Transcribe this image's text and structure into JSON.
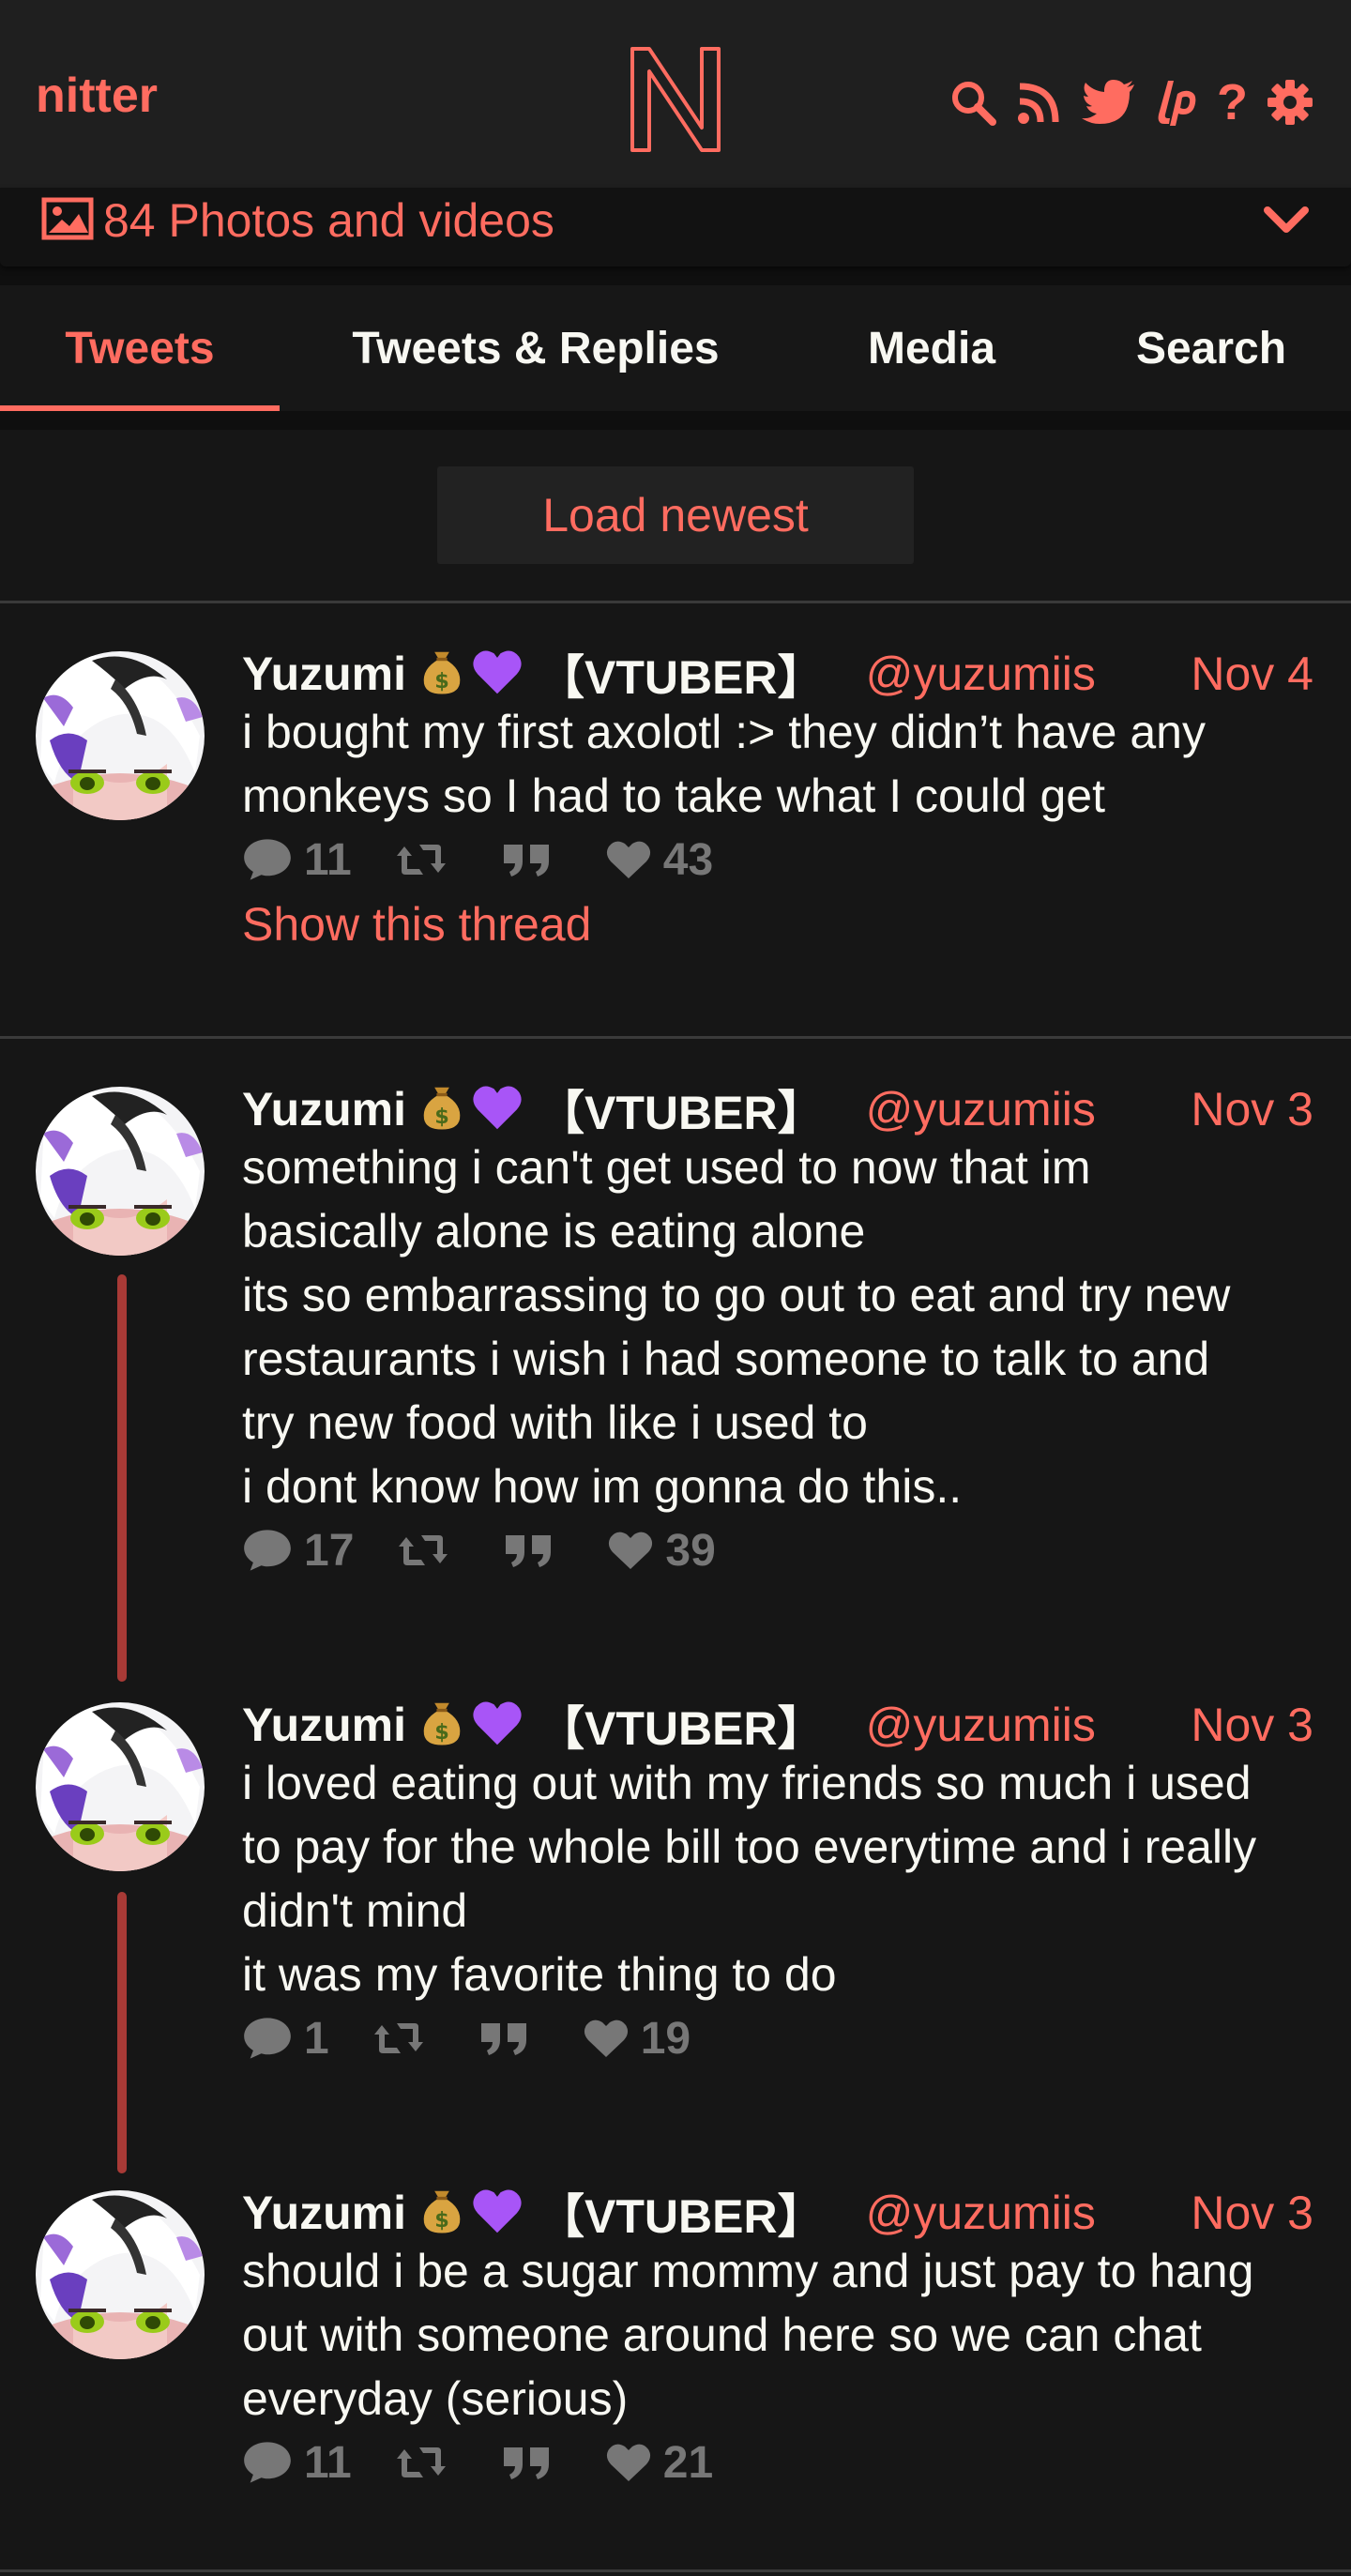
{
  "nav": {
    "brand": "nitter",
    "logo_letter": "N",
    "icons": [
      "search-icon",
      "rss-icon",
      "twitter-icon",
      "liberapay-icon",
      "help-icon",
      "settings-icon"
    ],
    "help_glyph": "?"
  },
  "photo_rail": {
    "label": "84 Photos and videos"
  },
  "tabs": [
    {
      "label": "Tweets",
      "active": true
    },
    {
      "label": "Tweets & Replies",
      "active": false
    },
    {
      "label": "Media",
      "active": false
    },
    {
      "label": "Search",
      "active": false
    }
  ],
  "timeline": {
    "load_newest": "Load newest",
    "tweets": [
      {
        "fullname": "Yuzumi",
        "tag": "【VTUBER】",
        "handle": "@yuzumiis",
        "date": "Nov 4",
        "content": "i bought my first axolotl :> they didn’t have any\nmonkeys so I had to take what I could get",
        "replies": "11",
        "likes": "43",
        "show_thread": "Show this thread"
      },
      {
        "fullname": "Yuzumi",
        "tag": "【VTUBER】",
        "handle": "@yuzumiis",
        "date": "Nov 3",
        "content": "something i can't get used to now that im\nbasically alone is eating alone\nits so embarrassing to go out to eat and try new\nrestaurants i wish i had someone to talk to and\ntry new food with like i used to\ni dont know how im gonna do this..",
        "replies": "17",
        "likes": "39"
      },
      {
        "fullname": "Yuzumi",
        "tag": "【VTUBER】",
        "handle": "@yuzumiis",
        "date": "Nov 3",
        "content": "i loved eating out with my friends so much i used\nto pay for the whole bill too everytime and i really\ndidn't mind\nit was my favorite thing to do",
        "replies": "1",
        "likes": "19"
      },
      {
        "fullname": "Yuzumi",
        "tag": "【VTUBER】",
        "handle": "@yuzumiis",
        "date": "Nov 3",
        "content": "should i be a sugar mommy and just pay to hang\nout with someone around here so we can chat\neveryday (serious)",
        "replies": "11",
        "likes": "21"
      }
    ]
  },
  "colors": {
    "accent": "#ff6c60",
    "background": "#161616",
    "navbar": "#1f1f1f",
    "stat": "#777777",
    "thread_line": "#a83a36"
  }
}
